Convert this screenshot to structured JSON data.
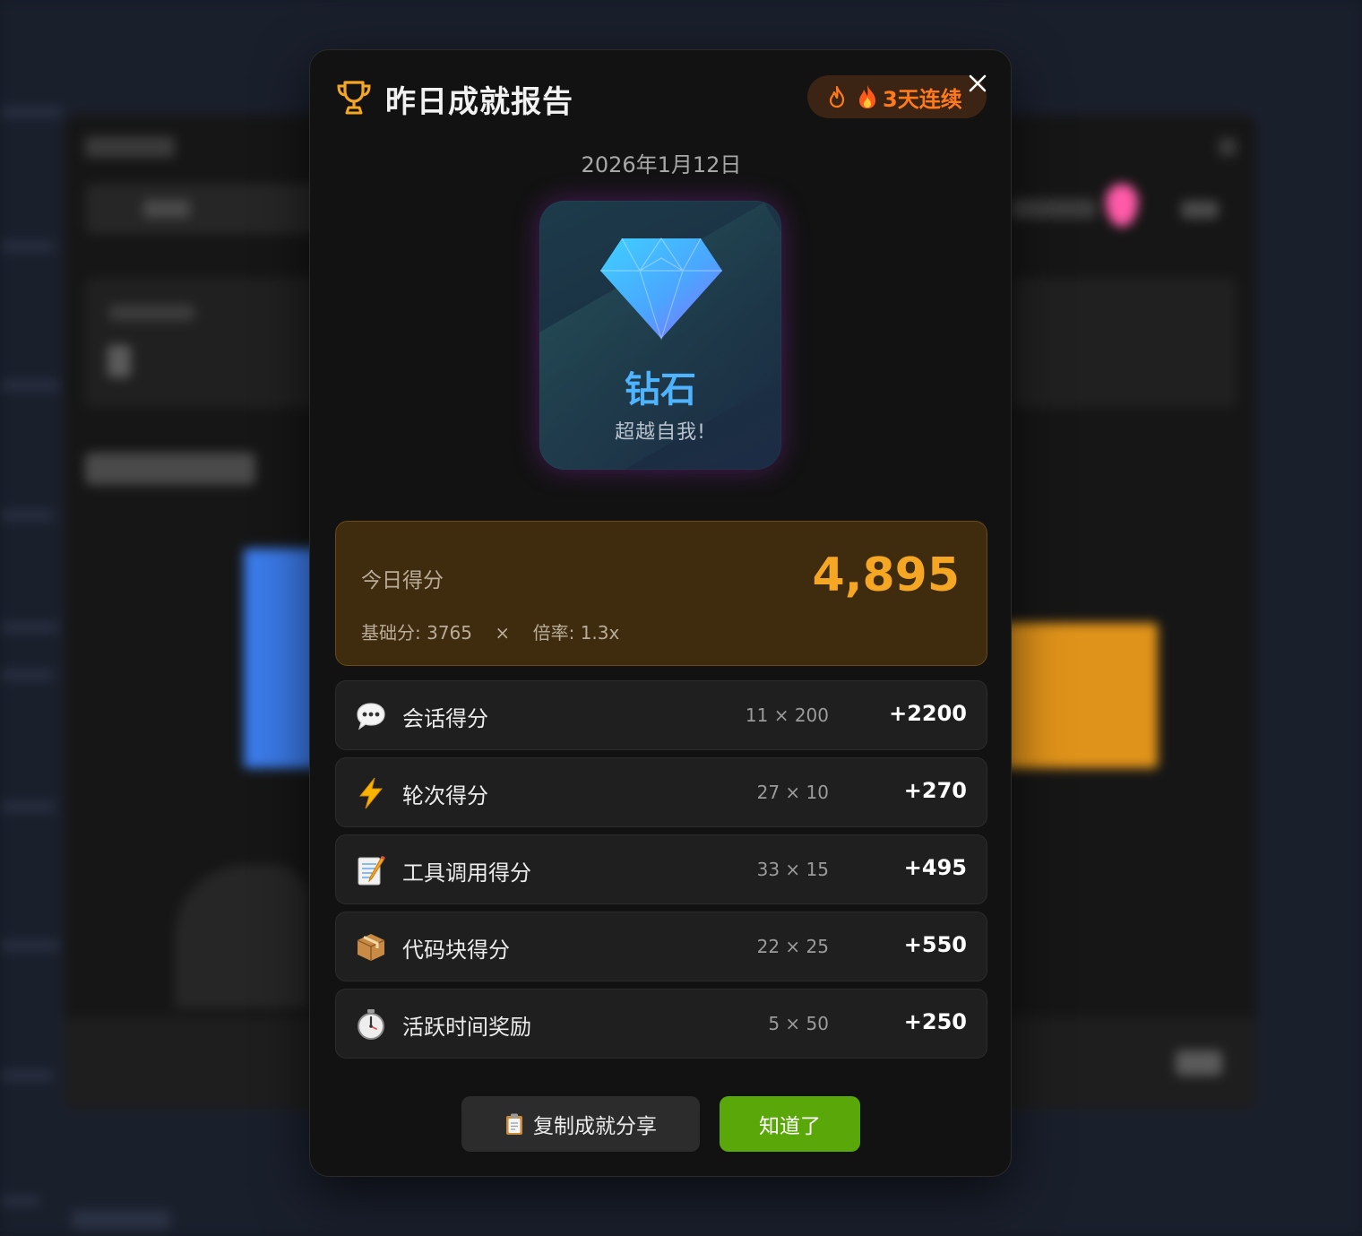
{
  "modal": {
    "title": "昨日成就报告",
    "streak_label": "3天连续",
    "date": "2026年1月12日",
    "badge": {
      "name": "钻石",
      "subtitle": "超越自我!"
    },
    "score": {
      "label": "今日得分",
      "value": "4,895",
      "formula": "基础分: 3765    ×    倍率: 1.3x"
    },
    "rows": [
      {
        "icon": "speech-bubble-icon",
        "label": "会话得分",
        "calc": "11 × 200",
        "points": "+2200"
      },
      {
        "icon": "lightning-icon",
        "label": "轮次得分",
        "calc": "27 × 10",
        "points": "+270"
      },
      {
        "icon": "memo-icon",
        "label": "工具调用得分",
        "calc": "33 × 15",
        "points": "+495"
      },
      {
        "icon": "package-icon",
        "label": "代码块得分",
        "calc": "22 × 25",
        "points": "+550"
      },
      {
        "icon": "stopwatch-icon",
        "label": "活跃时间奖励",
        "calc": "5 × 50",
        "points": "+250"
      }
    ],
    "buttons": {
      "copy": "复制成就分享",
      "ok": "知道了"
    }
  },
  "colors": {
    "accent_gold": "#f5a623",
    "streak_orange": "#ff7a1a",
    "ok_green": "#5aa70a",
    "diamond_blue": "#4fb4ff"
  }
}
